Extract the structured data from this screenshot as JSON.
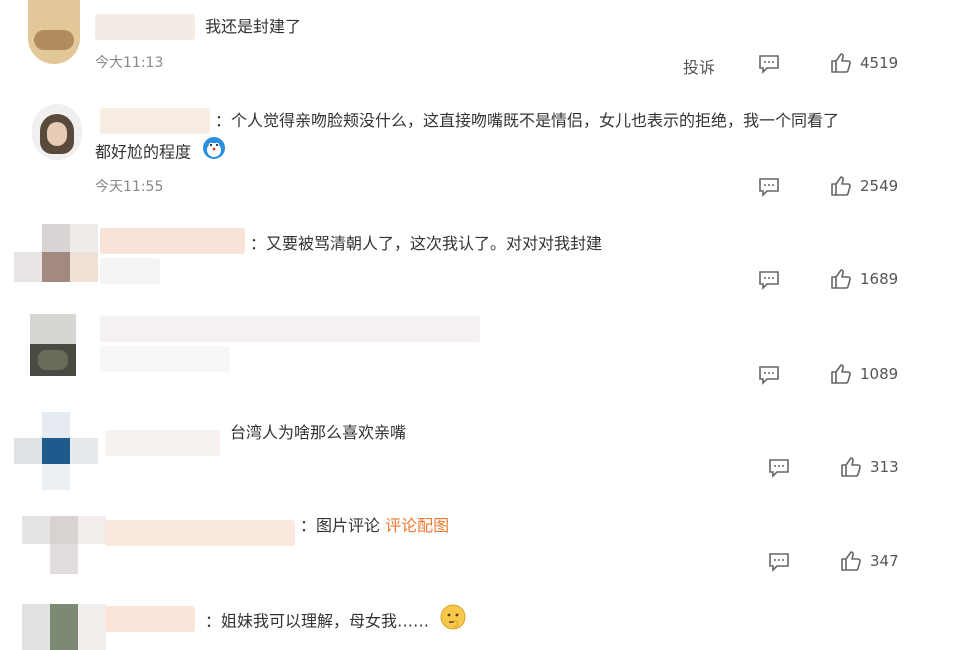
{
  "comments": [
    {
      "text": "我还是封建了",
      "time": "今大11:13",
      "report": "投诉",
      "likes": "4519"
    },
    {
      "text_line1": "：个人觉得亲吻脸颊没什么，这直接吻嘴既不是情侣，女儿也表示的拒绝，我一个同看了",
      "text_line2": "都好尬的程度",
      "time": "今天11:55",
      "likes": "2549"
    },
    {
      "text": "：又要被骂清朝人了，这次我认了。对对对我封建",
      "likes": "1689"
    },
    {
      "text": "",
      "likes": "1089"
    },
    {
      "text": "台湾人为啥那么喜欢亲嘴",
      "likes": "313"
    },
    {
      "text_prefix": "：图片评论 ",
      "link": "评论配图",
      "likes": "347"
    },
    {
      "text": "：姐妹我可以理解，母女我……"
    }
  ],
  "icons": {
    "comment": "comment-icon",
    "like": "thumbs-up-icon",
    "emoji": "emoji-icon"
  },
  "colors": {
    "link": "#f07a30",
    "time": "#888888"
  }
}
